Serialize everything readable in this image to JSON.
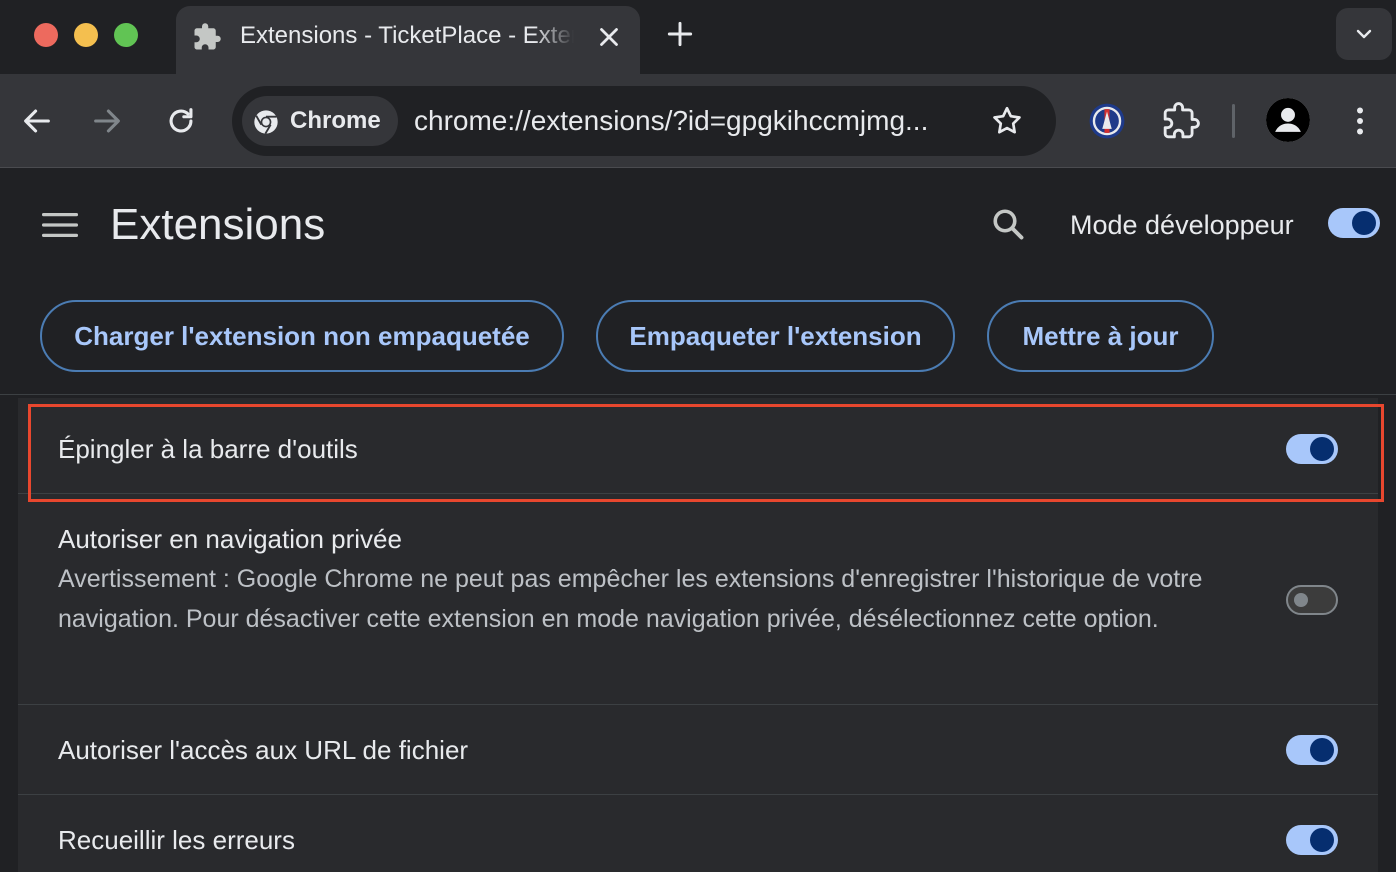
{
  "window": {
    "tab": {
      "title": "Extensions - TicketPlace - Extension",
      "icon": "puzzle-icon"
    },
    "new_tab_icon": "plus-icon",
    "tab_search_icon": "chevron-down-icon"
  },
  "toolbar": {
    "chip_label": "Chrome",
    "url": "chrome://extensions/?id=gpgkihccmjmg...",
    "icons": [
      "back-arrow-icon",
      "forward-arrow-icon",
      "reload-icon",
      "star-icon",
      "psg-extension-icon",
      "puzzle-icon",
      "profile-icon",
      "more-vert-icon"
    ]
  },
  "header": {
    "title": "Extensions",
    "dev_mode_label": "Mode développeur",
    "dev_mode_on": true
  },
  "actions": {
    "load_unpacked": "Charger l'extension non empaquetée",
    "pack": "Empaqueter l'extension",
    "update": "Mettre à jour"
  },
  "settings": [
    {
      "label": "Épingler à la barre d'outils",
      "enabled": true,
      "highlighted": true
    },
    {
      "label": "Autoriser en navigation privée",
      "description": "Avertissement : Google Chrome ne peut pas empêcher les extensions d'enregistrer l'historique de votre navigation. Pour désactiver cette extension en mode navigation privée, désélectionnez cette option.",
      "enabled": false
    },
    {
      "label": "Autoriser l'accès aux URL de fichier",
      "enabled": true
    },
    {
      "label": "Recueillir les erreurs",
      "enabled": true
    }
  ],
  "colors": {
    "accent": "#a8c7fa",
    "highlight_border": "#e8472e",
    "background": "#202124",
    "card": "#292a2d"
  }
}
